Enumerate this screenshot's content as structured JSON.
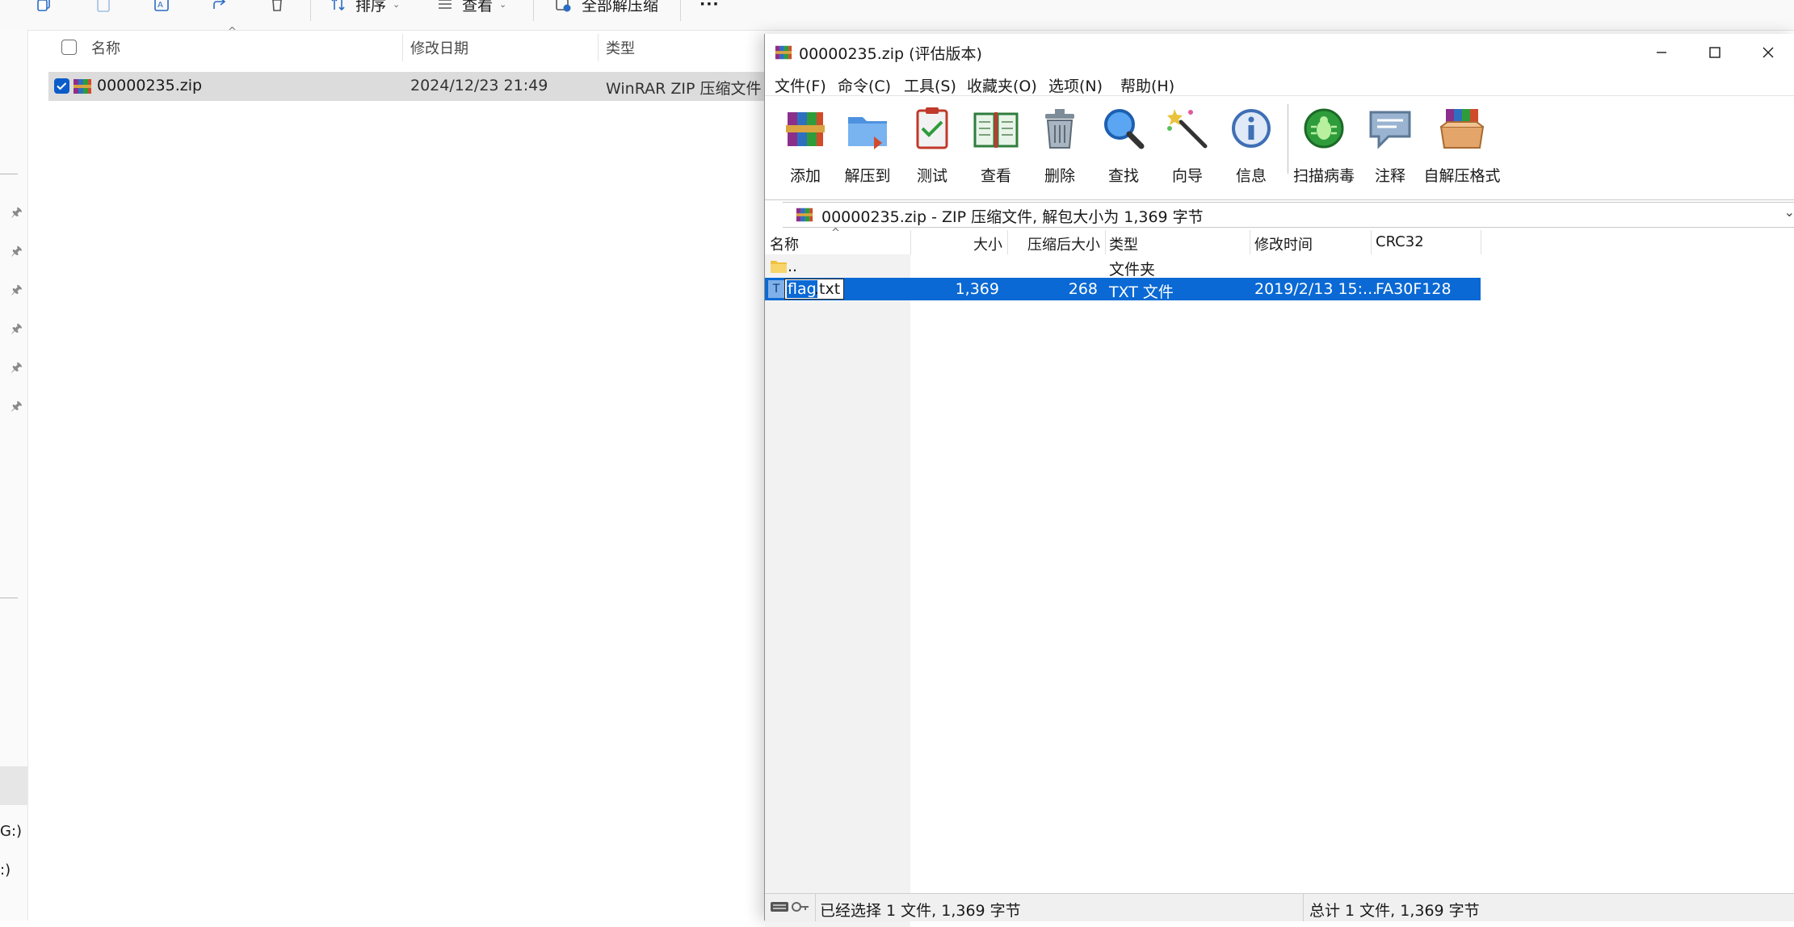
{
  "explorer": {
    "toolbar": {
      "sort_label": "排序",
      "view_label": "查看",
      "extract_all_label": "全部解压缩",
      "more_label": "···"
    },
    "columns": {
      "name": "名称",
      "modified": "修改日期",
      "type": "类型"
    },
    "files": [
      {
        "name": "00000235.zip",
        "modified": "2024/12/23 21:49",
        "type": "WinRAR ZIP 压缩文件",
        "selected": true
      }
    ],
    "sidebar": {
      "drive_1": "G:)",
      "drive_2": ":)"
    }
  },
  "winrar": {
    "title": "00000235.zip (评估版本)",
    "menu": [
      "文件(F)",
      "命令(C)",
      "工具(S)",
      "收藏夹(O)",
      "选项(N)",
      "帮助(H)"
    ],
    "toolbar": [
      {
        "label": "添加",
        "icon": "add-archive-icon"
      },
      {
        "label": "解压到",
        "icon": "extract-to-icon"
      },
      {
        "label": "测试",
        "icon": "test-icon"
      },
      {
        "label": "查看",
        "icon": "view-book-icon"
      },
      {
        "label": "删除",
        "icon": "delete-trash-icon"
      },
      {
        "label": "查找",
        "icon": "find-magnifier-icon"
      },
      {
        "label": "向导",
        "icon": "wizard-wand-icon"
      },
      {
        "label": "信息",
        "icon": "info-icon"
      },
      {
        "label": "扫描病毒",
        "icon": "virus-scan-icon"
      },
      {
        "label": "注释",
        "icon": "comment-icon"
      },
      {
        "label": "自解压格式",
        "icon": "sfx-box-icon"
      }
    ],
    "address": "00000235.zip - ZIP 压缩文件, 解包大小为 1,369 字节",
    "columns": {
      "name": "名称",
      "size": "大小",
      "packed": "压缩后大小",
      "type": "类型",
      "modified": "修改时间",
      "crc": "CRC32"
    },
    "rows": [
      {
        "name": "..",
        "size": "",
        "packed": "",
        "type": "文件夹",
        "modified": "",
        "crc": ""
      },
      {
        "name_selected": "flag",
        "name_rest": ".txt",
        "size": "1,369",
        "packed": "268",
        "type": "TXT 文件",
        "modified": "2019/2/13 15:...",
        "crc": "FA30F128"
      }
    ],
    "status_left": "已经选择 1 文件, 1,369 字节",
    "status_right": "总计 1 文件, 1,369 字节",
    "colors": {
      "selection": "#0a69d4",
      "name_column_bg": "#f2f2f2"
    }
  }
}
